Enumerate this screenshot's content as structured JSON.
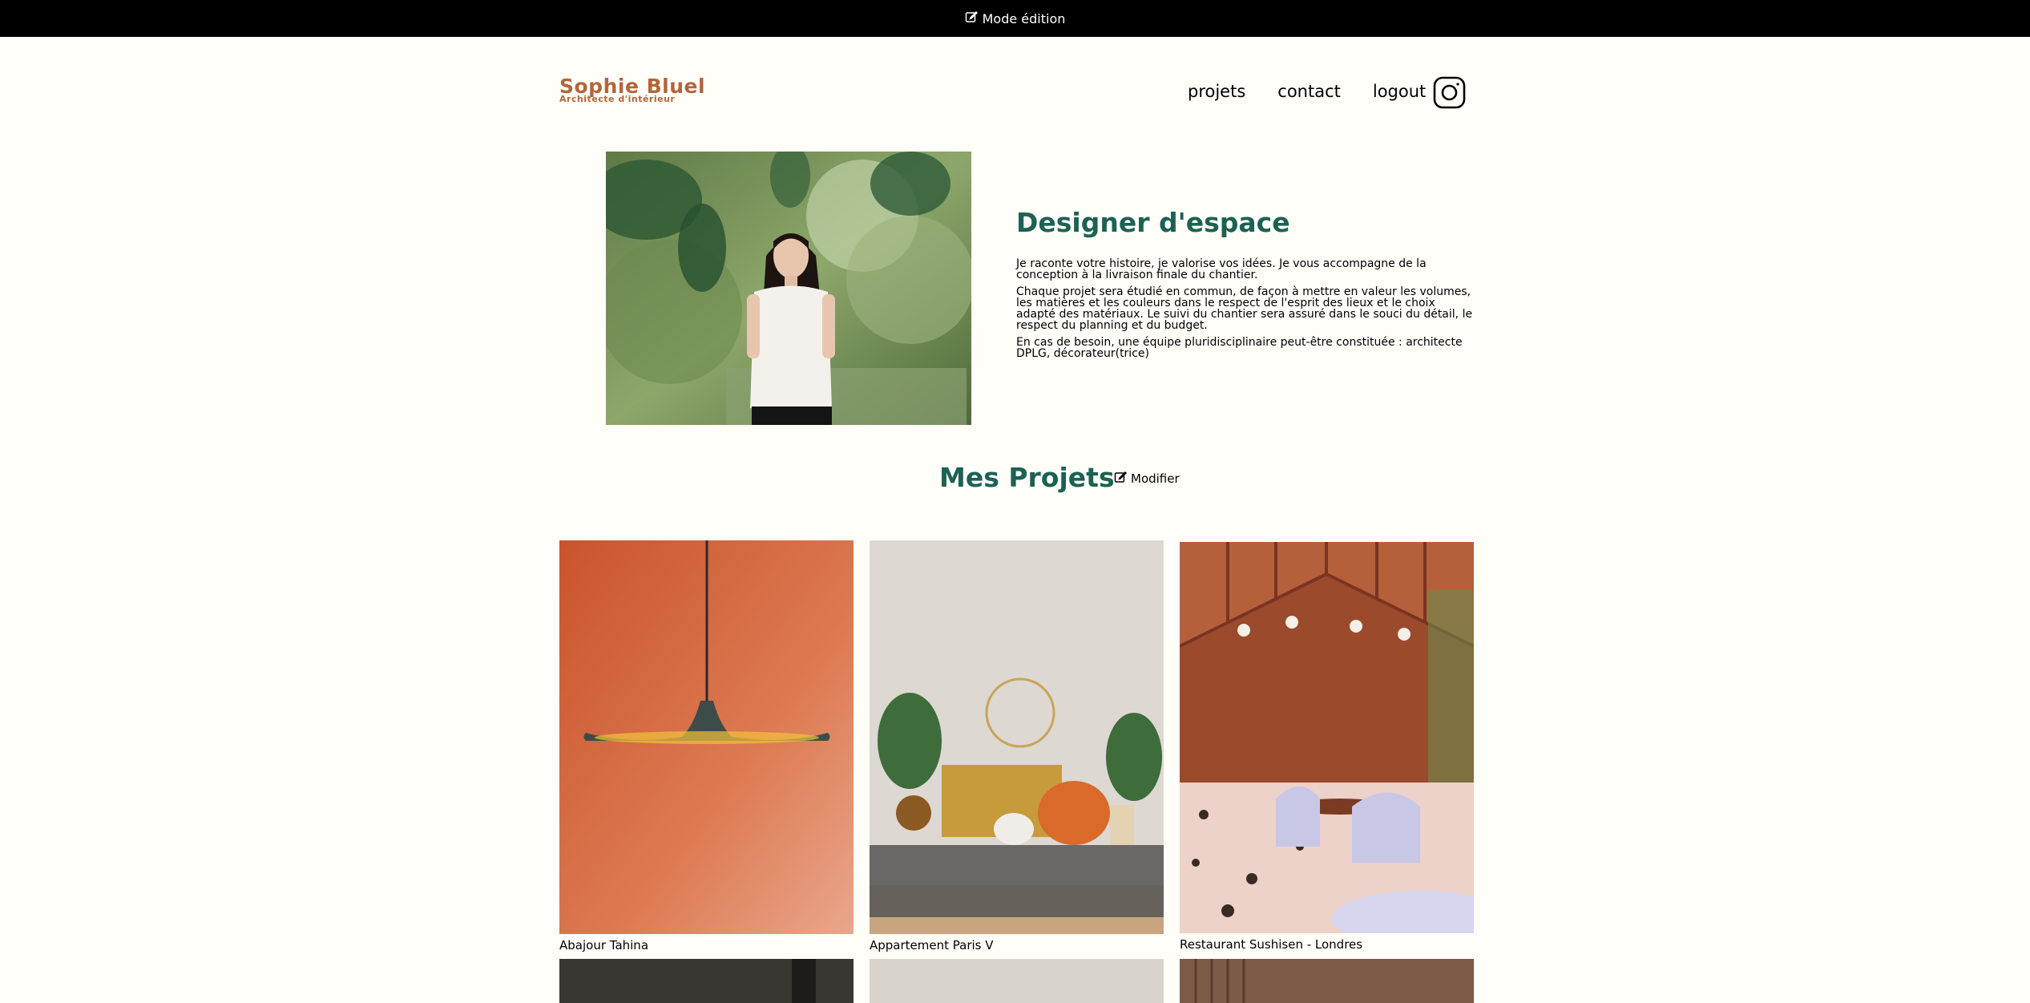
{
  "edit_bar": {
    "label": "Mode édition",
    "icon": "edit-icon"
  },
  "header": {
    "logo_title": "Sophie Bluel",
    "logo_subtitle": "Architecte d'intérieur",
    "nav": [
      "projets",
      "contact",
      "logout"
    ],
    "social_icon": "instagram-icon"
  },
  "intro": {
    "title": "Designer d'espace",
    "paragraphs": [
      "Je raconte votre histoire, je valorise vos idées. Je vous accompagne de la conception à la livraison finale du chantier.",
      "Chaque projet sera étudié en commun, de façon à mettre en valeur les volumes, les matières et les couleurs dans le respect de l'esprit des lieux et le choix adapté des matériaux. Le suivi du chantier sera assuré dans le souci du détail, le respect du planning et du budget.",
      "En cas de besoin, une équipe pluridisciplinaire peut-être constituée : architecte DPLG, décorateur(trice)"
    ]
  },
  "projects": {
    "title": "Mes Projets",
    "modify_label": "Modifier",
    "items": [
      {
        "caption": "Abajour Tahina"
      },
      {
        "caption": "Appartement Paris V"
      },
      {
        "caption": "Restaurant Sushisen - Londres"
      }
    ]
  },
  "colors": {
    "background": "#FFFEF8",
    "accent_green": "#1D6154",
    "logo_orange": "#B1663C",
    "edit_bar": "#000000"
  }
}
